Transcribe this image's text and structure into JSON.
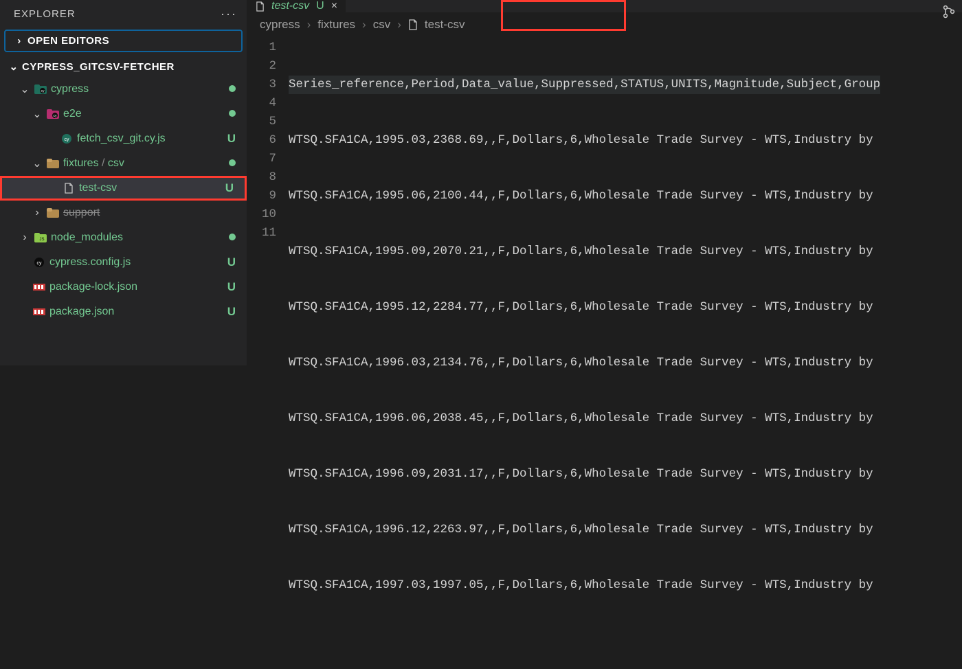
{
  "sidebar": {
    "title": "EXPLORER",
    "open_editors": "OPEN EDITORS",
    "project": "CYPRESS_GITCSV-FETCHER",
    "items": {
      "cypress": "cypress",
      "e2e": "e2e",
      "fetch": "fetch_csv_git.cy.js",
      "fixtures": "fixtures",
      "csv": "csv",
      "testcsv": "test-csv",
      "support": "support",
      "node_modules": "node_modules",
      "config": "cypress.config.js",
      "pkglock": "package-lock.json",
      "pkg": "package.json"
    },
    "u": "U",
    "slash": " / "
  },
  "tab": {
    "label": "test-csv",
    "status": "U",
    "close": "×"
  },
  "breadcrumbs": {
    "b0": "cypress",
    "b1": "fixtures",
    "b2": "csv",
    "b3": "test-csv",
    "sep": "›"
  },
  "editor": {
    "lines": {
      "n1": "1",
      "n2": "2",
      "n3": "3",
      "n4": "4",
      "n5": "5",
      "n6": "6",
      "n7": "7",
      "n8": "8",
      "n9": "9",
      "n10": "10",
      "n11": "11"
    },
    "l1": "Series_reference,Period,Data_value,Suppressed,STATUS,UNITS,Magnitude,Subject,Group",
    "l2": "WTSQ.SFA1CA,1995.03,2368.69,,F,Dollars,6,Wholesale Trade Survey - WTS,Industry by ",
    "l3": "WTSQ.SFA1CA,1995.06,2100.44,,F,Dollars,6,Wholesale Trade Survey - WTS,Industry by ",
    "l4": "WTSQ.SFA1CA,1995.09,2070.21,,F,Dollars,6,Wholesale Trade Survey - WTS,Industry by ",
    "l5": "WTSQ.SFA1CA,1995.12,2284.77,,F,Dollars,6,Wholesale Trade Survey - WTS,Industry by ",
    "l6": "WTSQ.SFA1CA,1996.03,2134.76,,F,Dollars,6,Wholesale Trade Survey - WTS,Industry by ",
    "l7": "WTSQ.SFA1CA,1996.06,2038.45,,F,Dollars,6,Wholesale Trade Survey - WTS,Industry by ",
    "l8": "WTSQ.SFA1CA,1996.09,2031.17,,F,Dollars,6,Wholesale Trade Survey - WTS,Industry by ",
    "l9": "WTSQ.SFA1CA,1996.12,2263.97,,F,Dollars,6,Wholesale Trade Survey - WTS,Industry by ",
    "l10": "WTSQ.SFA1CA,1997.03,1997.05,,F,Dollars,6,Wholesale Trade Survey - WTS,Industry by ",
    "l11": ""
  },
  "colors": {
    "accent_green": "#73c991",
    "highlight_red": "#ff3b30",
    "focus_blue": "#0e639c"
  }
}
